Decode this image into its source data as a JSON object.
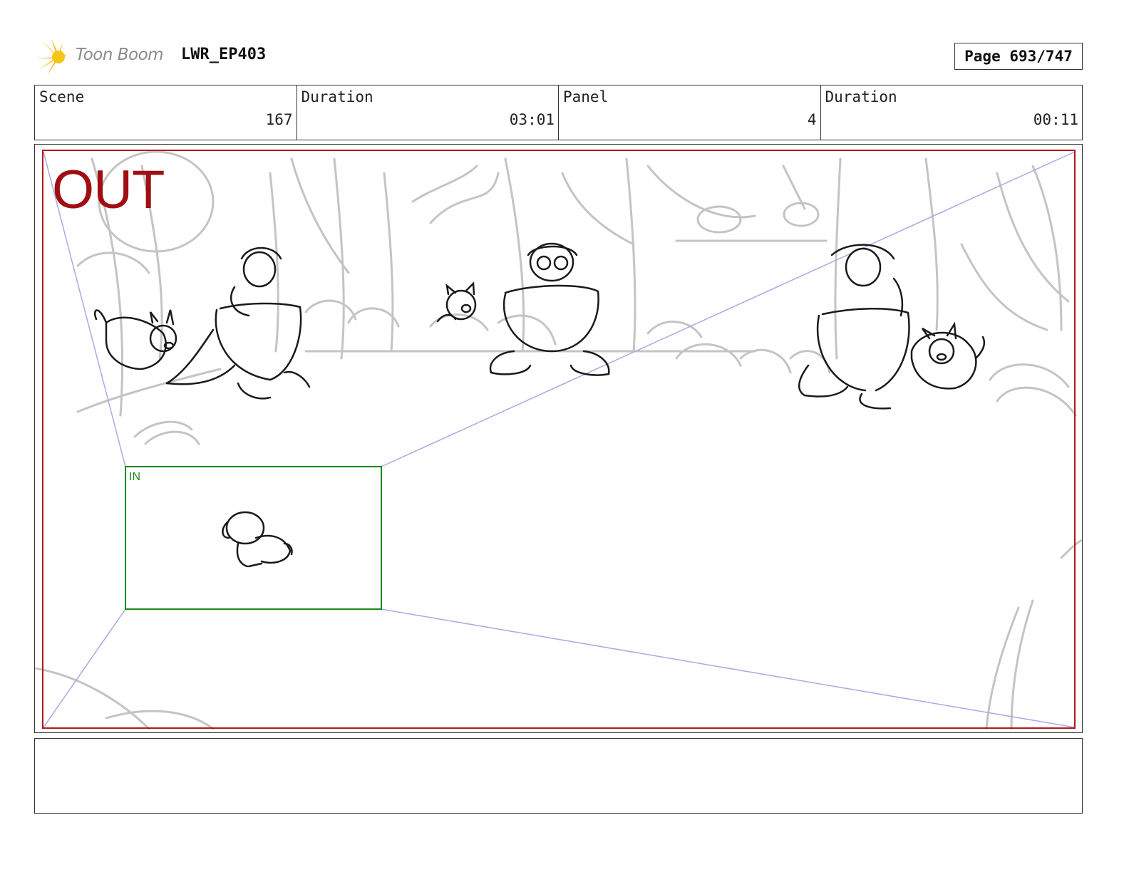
{
  "header": {
    "logo_text": "Toon Boom",
    "project": "LWR_EP403",
    "page": "Page 693/747"
  },
  "info": [
    {
      "label": "Scene",
      "value": "167"
    },
    {
      "label": "Duration",
      "value": "03:01"
    },
    {
      "label": "Panel",
      "value": "4"
    },
    {
      "label": "Duration",
      "value": "00:11"
    }
  ],
  "panel": {
    "out_label": "OUT",
    "in_label": "IN",
    "colors": {
      "out_frame": "#b01820",
      "in_frame": "#1a8a1a",
      "perspective": "#a9a9e8"
    }
  },
  "notes": ""
}
